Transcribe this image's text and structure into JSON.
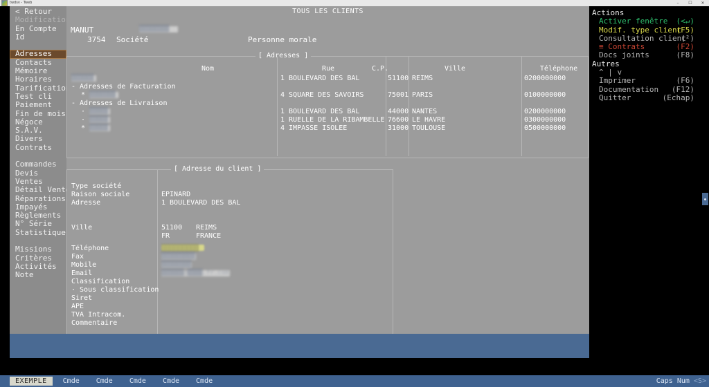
{
  "window": {
    "title": "twdsv - Tweb",
    "app_icon": "app-icon",
    "buttons": {
      "minimize": "–",
      "maximize": "⬜",
      "close": "✕"
    }
  },
  "screen_title": "TOUS LES CLIENTS",
  "sidebar": {
    "back": "< Retour",
    "mode": "Modification",
    "account_label": "En Compte",
    "id_label": "Id",
    "items": [
      {
        "label": "Adresses",
        "selected": true
      },
      {
        "label": "Contacts",
        "selected": false
      },
      {
        "label": "Mémoire",
        "selected": false
      },
      {
        "label": "Horaires",
        "selected": false
      },
      {
        "label": "Tarification",
        "selected": false
      },
      {
        "label": "Test cli",
        "selected": false
      },
      {
        "label": "Paiement",
        "selected": false
      },
      {
        "label": "Fin de mois",
        "selected": false
      },
      {
        "label": "Négoce",
        "selected": false
      },
      {
        "label": "S.A.V.",
        "selected": false
      },
      {
        "label": "Divers",
        "selected": false
      },
      {
        "label": "Contrats",
        "selected": false
      }
    ],
    "items2": [
      {
        "label": "Commandes"
      },
      {
        "label": "Devis"
      },
      {
        "label": "Ventes"
      },
      {
        "label": "Détail Ventes"
      },
      {
        "label": "Réparations"
      },
      {
        "label": "Impayés"
      },
      {
        "label": "Règlements"
      },
      {
        "label": "N° Série"
      },
      {
        "label": "Statistiques"
      }
    ],
    "items3": [
      {
        "label": "Missions"
      },
      {
        "label": "Critères"
      },
      {
        "label": "Activités"
      },
      {
        "label": "Note"
      }
    ]
  },
  "header": {
    "code": "MANUT",
    "name_redacted": "████████",
    "id": "3754",
    "societe_label": "Société",
    "personne": "Personne morale"
  },
  "adresses_panel": {
    "legend": "[ Adresses ]",
    "columns": [
      "Nom",
      "Rue",
      "C.P.",
      "Ville",
      "Téléphone"
    ],
    "rows": [
      {
        "nom": "██████",
        "redacted": true,
        "indent": 0,
        "rue": "1 BOULEVARD DES BAL",
        "cp": "51100",
        "ville": "REIMS",
        "tel": "0200000000"
      },
      {
        "nom": "- Adresses de Facturation",
        "redacted": false,
        "indent": 0,
        "rue": "",
        "cp": "",
        "ville": "",
        "tel": ""
      },
      {
        "nom": "███████",
        "redacted": true,
        "indent": 1,
        "bullet": "*",
        "rue": "4 SQUARE DES SAVOIRS",
        "cp": "75001",
        "ville": "PARIS",
        "tel": "0100000000"
      },
      {
        "nom": "- Adresses de Livraison",
        "redacted": false,
        "indent": 0,
        "rue": "",
        "cp": "",
        "ville": "",
        "tel": ""
      },
      {
        "nom": "█████",
        "redacted": true,
        "indent": 1,
        "bullet": "·",
        "rue": "1 BOULEVARD DES BAL",
        "cp": "44000",
        "ville": "NANTES",
        "tel": "0200000000"
      },
      {
        "nom": "█████",
        "redacted": true,
        "indent": 1,
        "bullet": "·",
        "rue": "1 RUELLE DE LA RIBAMBELLE",
        "cp": "76600",
        "ville": "LE HAVRE",
        "tel": "0300000000"
      },
      {
        "nom": "█████",
        "redacted": true,
        "indent": 1,
        "bullet": "*",
        "rue": "4 IMPASSE ISOLEE",
        "cp": "31000",
        "ville": "TOULOUSE",
        "tel": "0500000000"
      }
    ]
  },
  "client_panel": {
    "legend": "[ Adresse du client ]",
    "fields": [
      {
        "label": "Type société",
        "value": ""
      },
      {
        "label": "Raison sociale",
        "value": "EPINARD"
      },
      {
        "label": "Adresse",
        "value": "1 BOULEVARD DES BAL"
      },
      {
        "label": "Ville",
        "value": "51100",
        "value2": "REIMS"
      },
      {
        "label": "",
        "value": "FR",
        "value2": "FRANCE"
      },
      {
        "label": "Téléphone",
        "value": "█████████",
        "highlight": true
      },
      {
        "label": "Fax",
        "value": "█████████",
        "redacted": true
      },
      {
        "label": "Mobile",
        "value": "████████",
        "redacted": true
      },
      {
        "label": "Email",
        "value": "██████@████.fr.com",
        "redacted": true
      },
      {
        "label": "Classification",
        "value": ""
      },
      {
        "label": "· Sous classification",
        "value": ""
      },
      {
        "label": "Siret",
        "value": ""
      },
      {
        "label": "APE",
        "value": ""
      },
      {
        "label": "TVA Intracom.",
        "value": ""
      },
      {
        "label": "Commentaire",
        "value": ""
      }
    ]
  },
  "actions": {
    "title": "Actions",
    "items": [
      {
        "label": "Activer fenêtre",
        "key": "(<↵)",
        "color": "g"
      },
      {
        "label": "Modif. type client",
        "key": "(F5)",
        "color": "y"
      },
      {
        "label": "Consultation client",
        "key": "(²)",
        "color": "n"
      },
      {
        "label": "≡ Contrats",
        "key": "(F2)",
        "color": "r"
      },
      {
        "label": "Docs joints",
        "key": "(F8)",
        "color": "n"
      }
    ],
    "others_title": "Autres",
    "nav": "^ | v",
    "others": [
      {
        "label": "Imprimer",
        "key": "(F6)",
        "color": "n"
      },
      {
        "label": "Documentation",
        "key": "(F12)",
        "color": "n"
      },
      {
        "label": "Quitter",
        "key": "(Echap)",
        "color": "n"
      }
    ]
  },
  "statusbar": {
    "selected": "EXEMPLE",
    "tabs": [
      "Cmde",
      "Cmde",
      "Cmde",
      "Cmde",
      "Cmde"
    ],
    "caps": "Caps",
    "num": "Num",
    "server": "<S>"
  }
}
